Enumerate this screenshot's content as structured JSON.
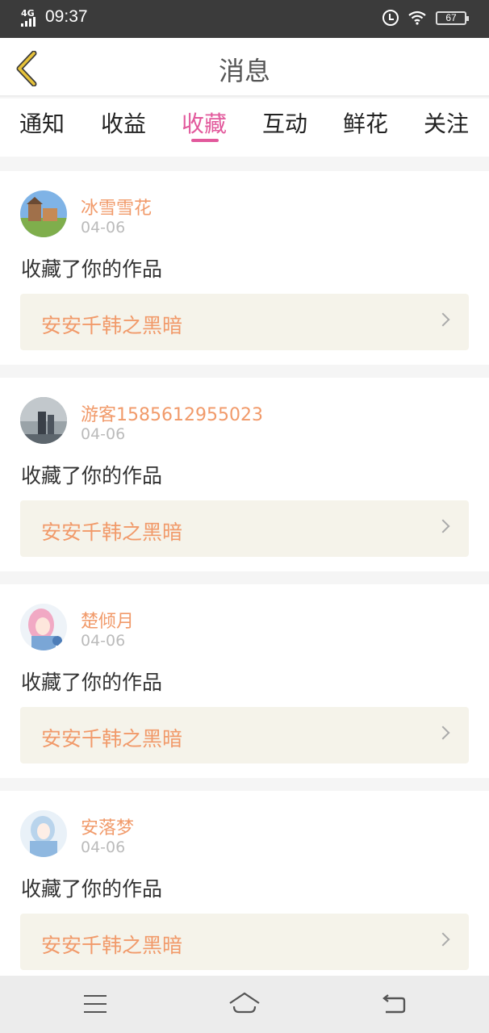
{
  "status_bar": {
    "network": "4G",
    "time": "09:37",
    "battery": "67"
  },
  "header": {
    "title": "消息"
  },
  "tabs": [
    {
      "label": "通知"
    },
    {
      "label": "收益"
    },
    {
      "label": "收藏",
      "active": true
    },
    {
      "label": "互动"
    },
    {
      "label": "鲜花"
    },
    {
      "label": "关注"
    }
  ],
  "messages": [
    {
      "username": "冰雪雪花",
      "date": "04-06",
      "action": "收藏了你的作品",
      "work_title": "安安千韩之黑暗"
    },
    {
      "username": "游客1585612955023",
      "date": "04-06",
      "action": "收藏了你的作品",
      "work_title": "安安千韩之黑暗"
    },
    {
      "username": "楚倾月",
      "date": "04-06",
      "action": "收藏了你的作品",
      "work_title": "安安千韩之黑暗"
    },
    {
      "username": "安落梦",
      "date": "04-06",
      "action": "收藏了你的作品",
      "work_title": "安安千韩之黑暗"
    }
  ],
  "colors": {
    "accent": "#e2599c",
    "username": "#f19a6a",
    "work_bg": "#f5f3ea",
    "status_bar": "#3b3b3b"
  },
  "icons": {
    "back": "chevron-left-icon",
    "menu": "menu-icon",
    "home": "home-icon",
    "return": "return-icon"
  }
}
